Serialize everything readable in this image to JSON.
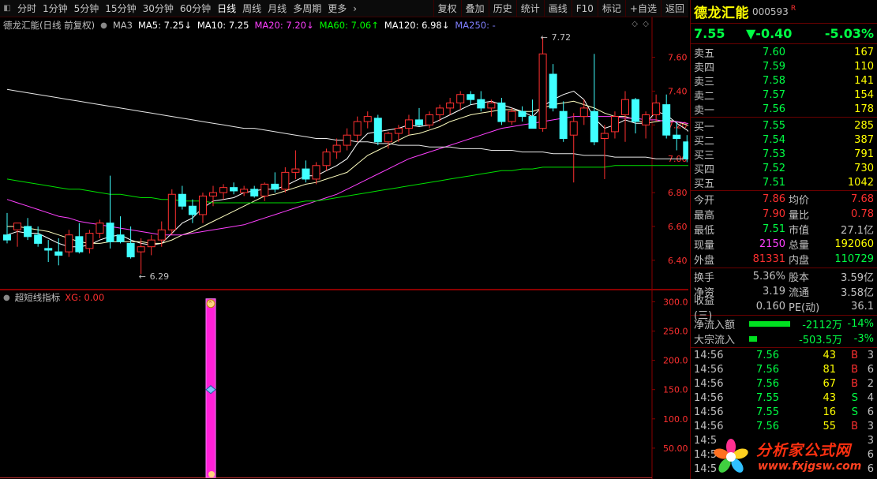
{
  "toolbar": {
    "left_items": [
      "分时",
      "1分钟",
      "5分钟",
      "15分钟",
      "30分钟",
      "60分钟",
      "日线",
      "周线",
      "月线",
      "多周期",
      "更多"
    ],
    "active_item": "日线",
    "more_arrow": "›",
    "right_items": [
      "复权",
      "叠加",
      "历史",
      "统计",
      "画线",
      "F10",
      "标记",
      "+自选",
      "返回"
    ]
  },
  "main_chart": {
    "title": "德龙汇能(日线 前复权)",
    "ma_legend": [
      {
        "label": "MA3",
        "color": "#c0c0c0"
      },
      {
        "label": "MA5: 7.25↓",
        "color": "#ffffff"
      },
      {
        "label": "MA10: 7.25",
        "color": "#ffffff"
      },
      {
        "label": "MA20: 7.20↓",
        "color": "#ff40ff"
      },
      {
        "label": "MA60: 7.06↑",
        "color": "#00ff00"
      },
      {
        "label": "MA120: 6.98↓",
        "color": "#ffffff"
      },
      {
        "label": "MA250: -",
        "color": "#8080ff"
      }
    ],
    "high_mark": "7.72",
    "low_mark": "6.29",
    "y_ticks": [
      "7.60",
      "7.40",
      "7.20",
      "7.00",
      "6.80",
      "6.60",
      "6.40"
    ]
  },
  "chart_data": {
    "type": "candlestick",
    "series_name": "德龙汇能 日线",
    "ylim": [
      6.25,
      7.78
    ],
    "y_ticks": [
      7.6,
      7.4,
      7.2,
      7.0,
      6.8,
      6.6,
      6.4
    ],
    "candles": [
      [
        6.55,
        6.68,
        6.5,
        6.52
      ],
      [
        6.58,
        6.62,
        6.48,
        6.62
      ],
      [
        6.6,
        6.65,
        6.52,
        6.54
      ],
      [
        6.55,
        6.6,
        6.48,
        6.5
      ],
      [
        6.47,
        6.52,
        6.39,
        6.46
      ],
      [
        6.45,
        6.53,
        6.37,
        6.43
      ],
      [
        6.45,
        6.58,
        6.42,
        6.55
      ],
      [
        6.54,
        6.62,
        6.44,
        6.45
      ],
      [
        6.47,
        6.58,
        6.44,
        6.56
      ],
      [
        6.56,
        6.64,
        6.53,
        6.62
      ],
      [
        6.62,
        6.9,
        6.47,
        6.51
      ],
      [
        6.55,
        6.66,
        6.5,
        6.51
      ],
      [
        6.5,
        6.6,
        6.41,
        6.42
      ],
      [
        6.45,
        6.53,
        6.32,
        6.48
      ],
      [
        6.48,
        6.55,
        6.43,
        6.52
      ],
      [
        6.52,
        6.63,
        6.48,
        6.58
      ],
      [
        6.58,
        6.82,
        6.55,
        6.79
      ],
      [
        6.79,
        6.84,
        6.7,
        6.72
      ],
      [
        6.72,
        6.76,
        6.62,
        6.67
      ],
      [
        6.67,
        6.8,
        6.62,
        6.78
      ],
      [
        6.78,
        6.84,
        6.72,
        6.8
      ],
      [
        6.8,
        6.85,
        6.76,
        6.83
      ],
      [
        6.83,
        6.86,
        6.79,
        6.81
      ],
      [
        6.8,
        6.84,
        6.78,
        6.82
      ],
      [
        6.82,
        6.84,
        6.77,
        6.78
      ],
      [
        6.78,
        6.86,
        6.75,
        6.85
      ],
      [
        6.85,
        6.92,
        6.8,
        6.82
      ],
      [
        6.82,
        6.95,
        6.8,
        6.92
      ],
      [
        6.92,
        7.05,
        6.88,
        6.94
      ],
      [
        6.94,
        6.99,
        6.86,
        6.88
      ],
      [
        6.88,
        6.98,
        6.85,
        6.96
      ],
      [
        6.96,
        7.06,
        6.93,
        7.04
      ],
      [
        7.04,
        7.12,
        7.0,
        7.08
      ],
      [
        7.08,
        7.18,
        7.05,
        7.14
      ],
      [
        7.14,
        7.25,
        7.1,
        7.22
      ],
      [
        7.22,
        7.28,
        7.18,
        7.25
      ],
      [
        7.24,
        7.26,
        7.08,
        7.1
      ],
      [
        7.1,
        7.16,
        7.06,
        7.15
      ],
      [
        7.15,
        7.2,
        7.1,
        7.18
      ],
      [
        7.18,
        7.26,
        7.14,
        7.23
      ],
      [
        7.23,
        7.3,
        7.19,
        7.2
      ],
      [
        7.2,
        7.28,
        7.18,
        7.26
      ],
      [
        7.26,
        7.32,
        7.22,
        7.3
      ],
      [
        7.3,
        7.36,
        7.26,
        7.33
      ],
      [
        7.33,
        7.4,
        7.29,
        7.38
      ],
      [
        7.38,
        7.4,
        7.32,
        7.35
      ],
      [
        7.35,
        7.4,
        7.28,
        7.3
      ],
      [
        7.3,
        7.35,
        7.25,
        7.33
      ],
      [
        7.33,
        7.36,
        7.2,
        7.22
      ],
      [
        7.22,
        7.3,
        7.2,
        7.28
      ],
      [
        7.28,
        7.31,
        7.22,
        7.25
      ],
      [
        7.25,
        7.35,
        7.2,
        7.18
      ],
      [
        7.18,
        7.72,
        7.16,
        7.62
      ],
      [
        7.5,
        7.56,
        7.28,
        7.3
      ],
      [
        7.28,
        7.34,
        7.1,
        7.12
      ],
      [
        7.14,
        7.27,
        6.86,
        7.22
      ],
      [
        7.25,
        7.35,
        7.2,
        7.3
      ],
      [
        7.28,
        7.62,
        7.08,
        7.1
      ],
      [
        7.12,
        7.2,
        6.88,
        7.15
      ],
      [
        7.16,
        7.28,
        7.12,
        7.25
      ],
      [
        7.26,
        7.4,
        7.1,
        7.35
      ],
      [
        7.35,
        7.36,
        7.15,
        7.22
      ],
      [
        7.2,
        7.28,
        7.12,
        7.26
      ],
      [
        7.26,
        7.38,
        7.22,
        7.33
      ],
      [
        7.32,
        7.38,
        7.12,
        7.14
      ],
      [
        7.14,
        7.22,
        7.05,
        7.12
      ],
      [
        7.1,
        7.14,
        6.98,
        7.0
      ],
      [
        7.02,
        7.15,
        6.92,
        6.95
      ],
      [
        6.96,
        7.02,
        6.92,
        6.98
      ],
      [
        7.0,
        7.14,
        6.98,
        7.12
      ],
      [
        7.12,
        7.4,
        7.08,
        7.38
      ],
      [
        7.38,
        7.42,
        7.18,
        7.2
      ],
      [
        7.2,
        7.3,
        7.18,
        7.28
      ],
      [
        7.28,
        7.32,
        7.16,
        7.18
      ],
      [
        7.18,
        7.28,
        7.15,
        7.25
      ],
      [
        7.25,
        7.35,
        7.22,
        7.32
      ],
      [
        7.32,
        7.4,
        7.28,
        7.38
      ],
      [
        7.38,
        7.42,
        7.3,
        7.34
      ],
      [
        7.34,
        7.42,
        7.28,
        7.3
      ],
      [
        7.3,
        7.33,
        7.18,
        7.2
      ],
      [
        7.2,
        7.23,
        7.08,
        7.1
      ],
      [
        7.1,
        7.14,
        7.06,
        7.12
      ]
    ],
    "ma_series": {
      "MA5": {
        "color": "#ffffff",
        "values": [
          6.55,
          6.57,
          6.56,
          6.56,
          6.53,
          6.5,
          6.48,
          6.48,
          6.49,
          6.52,
          6.54,
          6.55,
          6.52,
          6.5,
          6.49,
          6.5,
          6.56,
          6.62,
          6.65,
          6.71,
          6.75,
          6.76,
          6.77,
          6.8,
          6.81,
          6.82,
          6.82,
          6.84,
          6.87,
          6.9,
          6.9,
          6.93,
          6.96,
          7.0,
          7.09,
          7.15,
          7.16,
          7.17,
          7.18,
          7.2,
          7.19,
          7.2,
          7.23,
          7.26,
          7.29,
          7.32,
          7.33,
          7.34,
          7.32,
          7.3,
          7.28,
          7.25,
          7.31,
          7.35,
          7.38,
          7.4,
          7.35,
          7.24,
          7.18,
          7.2,
          7.23,
          7.21,
          7.21,
          7.28,
          7.26,
          7.21,
          7.17,
          7.11,
          7.04,
          7.03,
          7.09,
          7.13,
          7.19,
          7.28,
          7.26,
          7.25,
          7.27,
          7.29,
          7.31,
          7.31,
          7.26,
          7.25
        ]
      },
      "MA10": {
        "color": "#ffffc0",
        "values": [
          6.6,
          6.6,
          6.59,
          6.58,
          6.57,
          6.55,
          6.53,
          6.51,
          6.5,
          6.5,
          6.51,
          6.51,
          6.51,
          6.51,
          6.5,
          6.5,
          6.52,
          6.55,
          6.57,
          6.6,
          6.63,
          6.66,
          6.69,
          6.72,
          6.75,
          6.78,
          6.79,
          6.81,
          6.83,
          6.85,
          6.86,
          6.88,
          6.9,
          6.92,
          6.97,
          7.02,
          7.05,
          7.08,
          7.11,
          7.14,
          7.15,
          7.17,
          7.19,
          7.22,
          7.24,
          7.26,
          7.27,
          7.28,
          7.29,
          7.29,
          7.28,
          7.28,
          7.3,
          7.32,
          7.33,
          7.34,
          7.32,
          7.3,
          7.27,
          7.25,
          7.25,
          7.23,
          7.21,
          7.22,
          7.23,
          7.22,
          7.2,
          7.17,
          7.14,
          7.12,
          7.11,
          7.12,
          7.14,
          7.16,
          7.17,
          7.19,
          7.21,
          7.23,
          7.25,
          7.26,
          7.26,
          7.25
        ]
      },
      "MA20": {
        "color": "#ff40ff",
        "values": [
          6.76,
          6.74,
          6.72,
          6.7,
          6.68,
          6.66,
          6.65,
          6.63,
          6.62,
          6.61,
          6.6,
          6.59,
          6.58,
          6.57,
          6.56,
          6.55,
          6.55,
          6.55,
          6.56,
          6.57,
          6.58,
          6.59,
          6.6,
          6.61,
          6.63,
          6.65,
          6.67,
          6.69,
          6.71,
          6.73,
          6.75,
          6.77,
          6.79,
          6.82,
          6.85,
          6.88,
          6.91,
          6.94,
          6.97,
          7.0,
          7.02,
          7.04,
          7.06,
          7.08,
          7.1,
          7.12,
          7.14,
          7.16,
          7.18,
          7.19,
          7.2,
          7.21,
          7.22,
          7.23,
          7.24,
          7.25,
          7.25,
          7.25,
          7.25,
          7.25,
          7.24,
          7.24,
          7.23,
          7.23,
          7.22,
          7.22,
          7.21,
          7.2,
          7.19,
          7.18,
          7.18,
          7.18,
          7.18,
          7.19,
          7.19,
          7.2,
          7.2,
          7.21,
          7.21,
          7.21,
          7.2,
          7.2
        ]
      },
      "MA60": {
        "color": "#00e000",
        "values": [
          6.88,
          6.87,
          6.86,
          6.85,
          6.84,
          6.83,
          6.82,
          6.82,
          6.81,
          6.8,
          6.79,
          6.79,
          6.78,
          6.77,
          6.77,
          6.76,
          6.76,
          6.75,
          6.75,
          6.75,
          6.74,
          6.74,
          6.74,
          6.74,
          6.74,
          6.74,
          6.74,
          6.74,
          6.74,
          6.75,
          6.75,
          6.76,
          6.77,
          6.78,
          6.79,
          6.8,
          6.81,
          6.82,
          6.83,
          6.84,
          6.85,
          6.86,
          6.87,
          6.88,
          6.89,
          6.9,
          6.91,
          6.92,
          6.93,
          6.93,
          6.94,
          6.94,
          6.95,
          6.95,
          6.95,
          6.95,
          6.95,
          6.95,
          6.95,
          6.96,
          6.96,
          6.96,
          6.96,
          6.96,
          6.96,
          6.96,
          6.96,
          6.96,
          6.96,
          6.96,
          6.97,
          6.97,
          6.98,
          6.99,
          7.0,
          7.01,
          7.02,
          7.03,
          7.04,
          7.05,
          7.06,
          7.06
        ]
      },
      "MA120": {
        "color": "#e8e8e8",
        "values": [
          7.41,
          7.4,
          7.39,
          7.38,
          7.37,
          7.36,
          7.35,
          7.34,
          7.33,
          7.32,
          7.31,
          7.3,
          7.29,
          7.28,
          7.27,
          7.26,
          7.25,
          7.24,
          7.23,
          7.22,
          7.21,
          7.2,
          7.19,
          7.18,
          7.18,
          7.17,
          7.16,
          7.15,
          7.14,
          7.13,
          7.12,
          7.12,
          7.11,
          7.11,
          7.1,
          7.1,
          7.09,
          7.09,
          7.08,
          7.08,
          7.08,
          7.07,
          7.07,
          7.07,
          7.06,
          7.06,
          7.06,
          7.05,
          7.05,
          7.05,
          7.04,
          7.04,
          7.04,
          7.03,
          7.03,
          7.03,
          7.02,
          7.02,
          7.02,
          7.01,
          7.01,
          7.01,
          7.01,
          7.0,
          7.0,
          7.0,
          7.0,
          6.99,
          6.99,
          6.99,
          6.99,
          6.99,
          6.98,
          6.98,
          6.98,
          6.98,
          6.98,
          6.98,
          6.98,
          6.98,
          6.98,
          6.98
        ]
      }
    }
  },
  "indicator": {
    "title": "超短线指标",
    "xg_label": "XG: 0.00",
    "y_ticks": [
      "300.0",
      "250.0",
      "200.0",
      "150.0",
      "100.0",
      "50.00"
    ],
    "ylim": [
      0,
      310
    ],
    "bar_index": 30,
    "bar_top": 305,
    "bar_bottom": 0,
    "bar_color": "#ff20d8"
  },
  "quote": {
    "name": "德龙汇能",
    "code": "000593",
    "r_badge": "R",
    "price": "7.55",
    "change": "▼-0.40",
    "change_pct": "-5.03%",
    "sells": [
      {
        "label": "卖五",
        "price": "7.60",
        "vol": "167"
      },
      {
        "label": "卖四",
        "price": "7.59",
        "vol": "110"
      },
      {
        "label": "卖三",
        "price": "7.58",
        "vol": "141"
      },
      {
        "label": "卖二",
        "price": "7.57",
        "vol": "154"
      },
      {
        "label": "卖一",
        "price": "7.56",
        "vol": "178"
      }
    ],
    "buys": [
      {
        "label": "买一",
        "price": "7.55",
        "vol": "285"
      },
      {
        "label": "买二",
        "price": "7.54",
        "vol": "387"
      },
      {
        "label": "买三",
        "price": "7.53",
        "vol": "791"
      },
      {
        "label": "买四",
        "price": "7.52",
        "vol": "730"
      },
      {
        "label": "买五",
        "price": "7.51",
        "vol": "1042"
      }
    ],
    "stats1": [
      {
        "l1": "今开",
        "v1": "7.86",
        "c1": "#ff3030",
        "l2": "均价",
        "v2": "7.68",
        "c2": "#ff3030"
      },
      {
        "l1": "最高",
        "v1": "7.90",
        "c1": "#ff3030",
        "l2": "量比",
        "v2": "0.78",
        "c2": "#ff3030"
      },
      {
        "l1": "最低",
        "v1": "7.51",
        "c1": "#00ff44",
        "l2": "市值",
        "v2": "27.1亿",
        "c2": "#c0c0c0"
      },
      {
        "l1": "现量",
        "v1": "2150",
        "c1": "#ff40ff",
        "l2": "总量",
        "v2": "192060",
        "c2": "#ffff00"
      },
      {
        "l1": "外盘",
        "v1": "81331",
        "c1": "#ff3030",
        "l2": "内盘",
        "v2": "110729",
        "c2": "#00ff44"
      }
    ],
    "stats2": [
      {
        "l1": "换手",
        "v1": "5.36%",
        "c1": "#c0c0c0",
        "l2": "股本",
        "v2": "3.59亿",
        "c2": "#c0c0c0"
      },
      {
        "l1": "净资",
        "v1": "3.19",
        "c1": "#c0c0c0",
        "l2": "流通",
        "v2": "3.58亿",
        "c2": "#c0c0c0"
      },
      {
        "l1": "收益(三)",
        "v1": "0.160",
        "c1": "#c0c0c0",
        "l2": "PE(动)",
        "v2": "36.1",
        "c2": "#c0c0c0"
      }
    ],
    "flows": [
      {
        "label": "净流入额",
        "bar_pct": 100,
        "amount": "-2112万",
        "pct": "-14%"
      },
      {
        "label": "大宗流入",
        "bar_pct": 20,
        "amount": "-503.5万",
        "pct": "-3%"
      }
    ],
    "ticks": [
      {
        "time": "14:56",
        "price": "7.56",
        "vol": "43",
        "bs": "B",
        "n": "3"
      },
      {
        "time": "14:56",
        "price": "7.56",
        "vol": "81",
        "bs": "B",
        "n": "6"
      },
      {
        "time": "14:56",
        "price": "7.56",
        "vol": "67",
        "bs": "B",
        "n": "2"
      },
      {
        "time": "14:56",
        "price": "7.55",
        "vol": "43",
        "bs": "S",
        "n": "4"
      },
      {
        "time": "14:56",
        "price": "7.55",
        "vol": "16",
        "bs": "S",
        "n": "6"
      },
      {
        "time": "14:56",
        "price": "7.56",
        "vol": "55",
        "bs": "B",
        "n": "3"
      },
      {
        "time": "14:5",
        "price": "",
        "vol": "",
        "bs": "",
        "n": "3"
      },
      {
        "time": "14:5",
        "price": "",
        "vol": "",
        "bs": "",
        "n": "6"
      },
      {
        "time": "14:5",
        "price": "",
        "vol": "",
        "bs": "",
        "n": "6"
      }
    ]
  },
  "watermark": {
    "text": "分析家公式网",
    "url": "www.fxjgsw.com"
  }
}
